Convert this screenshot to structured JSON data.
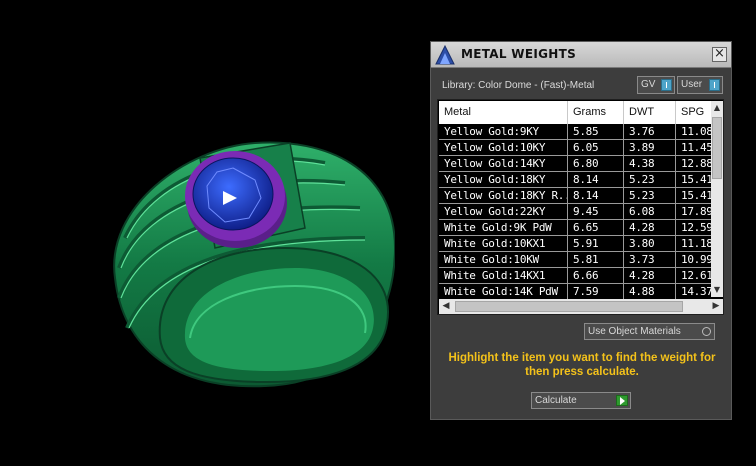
{
  "panel": {
    "title": "METAL WEIGHTS",
    "close_symbol": "×",
    "library_label": "Library: Color Dome - (Fast)-Metal",
    "gv_label": "GV",
    "user_label": "User",
    "columns": [
      "Metal",
      "Grams",
      "DWT",
      "SPG"
    ],
    "rows": [
      [
        "Yellow Gold:9KY",
        "5.85",
        "3.76",
        "11.08"
      ],
      [
        "Yellow Gold:10KY",
        "6.05",
        "3.89",
        "11.45"
      ],
      [
        "Yellow Gold:14KY",
        "6.80",
        "4.38",
        "12.88"
      ],
      [
        "Yellow Gold:18KY",
        "8.14",
        "5.23",
        "15.41"
      ],
      [
        "Yellow Gold:18KY R...",
        "8.14",
        "5.23",
        "15.41"
      ],
      [
        "Yellow Gold:22KY",
        "9.45",
        "6.08",
        "17.89"
      ],
      [
        "White Gold:9K PdW",
        "6.65",
        "4.28",
        "12.59"
      ],
      [
        "White Gold:10KX1",
        "5.91",
        "3.80",
        "11.18"
      ],
      [
        "White Gold:10KW",
        "5.81",
        "3.73",
        "10.99"
      ],
      [
        "White Gold:14KX1",
        "6.66",
        "4.28",
        "12.61"
      ],
      [
        "White Gold:14K PdW",
        "7.59",
        "4.88",
        "14.37"
      ]
    ],
    "use_object_label": "Use Object Materials",
    "hint_text": "Highlight the item you want to find the weight for then press calculate.",
    "calculate_label": "Calculate"
  },
  "icons": [
    "ring-3d-model",
    "play-icon",
    "rhino-logo-icon",
    "close-icon",
    "toggle-icon",
    "radio-icon",
    "go-arrow-icon",
    "scroll-arrow-icon"
  ],
  "colors": {
    "ring": "#1f8a4f",
    "gem": "#1b3db5",
    "bezel": "#7b2bb5",
    "hint": "#f4c21a",
    "accent": "#4ea4c9"
  }
}
